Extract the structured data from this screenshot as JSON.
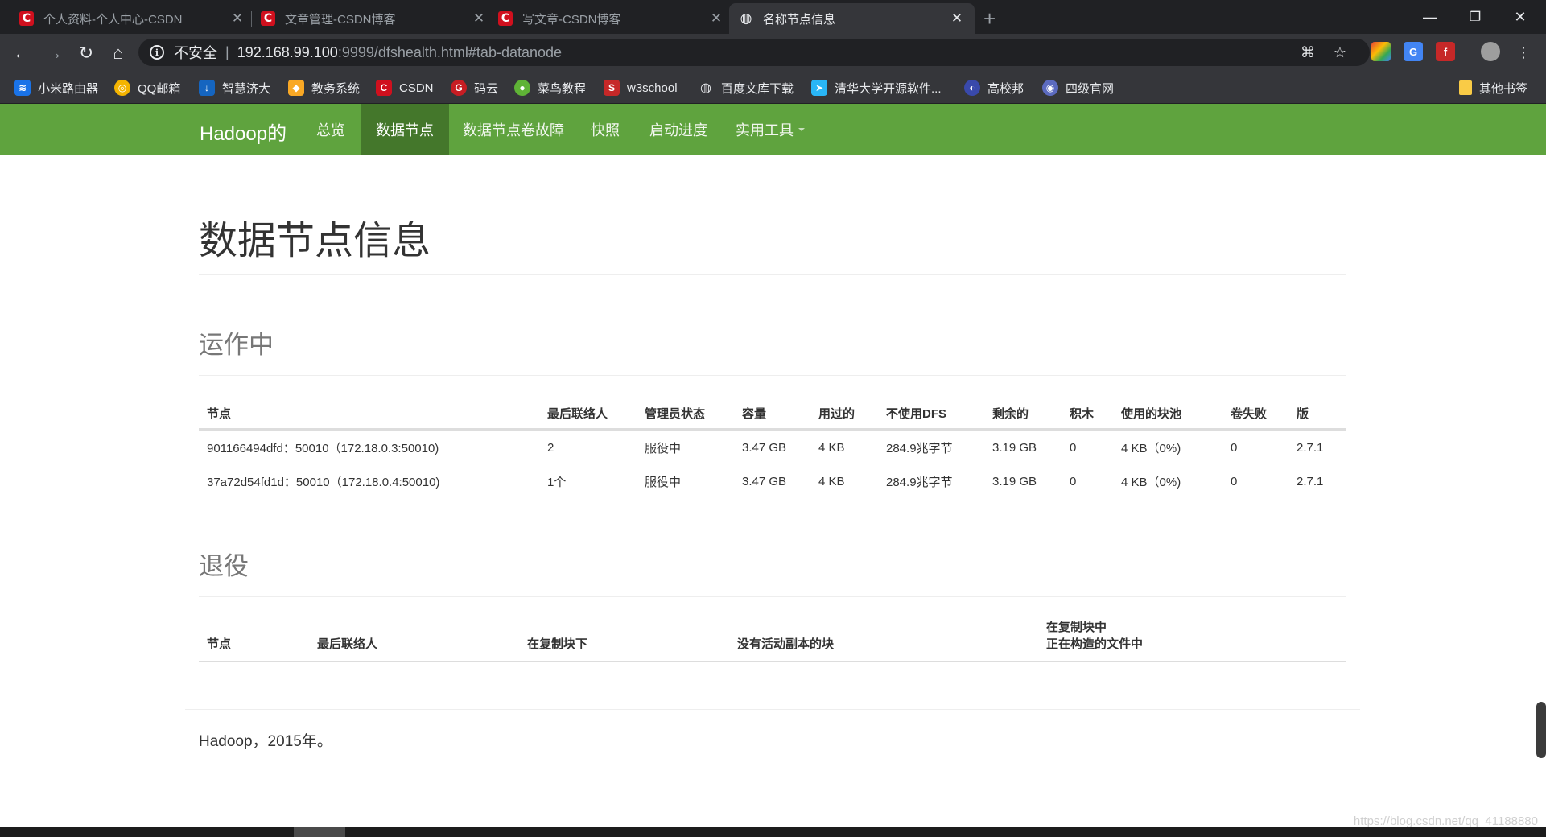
{
  "browser": {
    "tabs": [
      {
        "title": "个人资料-个人中心-CSDN",
        "icon": "csdn-icon",
        "active": false
      },
      {
        "title": "文章管理-CSDN博客",
        "icon": "csdn-icon",
        "active": false
      },
      {
        "title": "写文章-CSDN博客",
        "icon": "csdn-icon",
        "active": false
      },
      {
        "title": "名称节点信息",
        "icon": "globe-icon",
        "active": true
      }
    ],
    "address": {
      "insecure_label": "不安全",
      "host": "192.168.99.100",
      "path": ":9999/dfshealth.html#tab-datanode"
    },
    "bookmarks": [
      {
        "label": "小米路由器",
        "icon": "wifi-icon",
        "color": "#1a73e8"
      },
      {
        "label": "QQ邮箱",
        "icon": "qq-mail-icon",
        "color": "#f4b400"
      },
      {
        "label": "智慧济大",
        "icon": "download-icon",
        "color": "#1565c0"
      },
      {
        "label": "教务系统",
        "icon": "layers-icon",
        "color": "#f9a825"
      },
      {
        "label": "CSDN",
        "icon": "csdn-icon",
        "color": "#d0101e"
      },
      {
        "label": "码云",
        "icon": "gitee-icon",
        "color": "#c71d23"
      },
      {
        "label": "菜鸟教程",
        "icon": "runoob-icon",
        "color": "#5fb336"
      },
      {
        "label": "w3school",
        "icon": "w3school-icon",
        "color": "#c62828"
      },
      {
        "label": "百度文库下载",
        "icon": "globe-icon",
        "color": "#e8eaed"
      },
      {
        "label": "清华大学开源软件...",
        "icon": "tuna-icon",
        "color": "#29b6f6"
      },
      {
        "label": "高校邦",
        "icon": "gaoxiaobang-icon",
        "color": "#3949ab"
      },
      {
        "label": "四级官网",
        "icon": "cet-icon",
        "color": "#5c6bc0"
      },
      {
        "label": "其他书签",
        "icon": "folder-icon",
        "color": "#f9cb46"
      }
    ]
  },
  "navbar": {
    "brand": "Hadoop的",
    "items": [
      {
        "label": "总览",
        "active": false
      },
      {
        "label": "数据节点",
        "active": true
      },
      {
        "label": "数据节点卷故障",
        "active": false
      },
      {
        "label": "快照",
        "active": false
      },
      {
        "label": "启动进度",
        "active": false
      },
      {
        "label": "实用工具",
        "active": false,
        "dropdown": true
      }
    ]
  },
  "page": {
    "title": "数据节点信息",
    "in_operation": {
      "heading": "运作中",
      "columns": [
        "节点",
        "最后联络人",
        "管理员状态",
        "容量",
        "用过的",
        "不使用DFS",
        "剩余的",
        "积木",
        "使用的块池",
        "卷失败",
        "版"
      ],
      "rows": [
        [
          "901166494dfd：50010（172.18.0.3:50010)",
          "2",
          "服役中",
          "3.47 GB",
          "4 KB",
          "284.9兆字节",
          "3.19 GB",
          "0",
          "4 KB（0%)",
          "0",
          "2.7.1"
        ],
        [
          "37a72d54fd1d：50010（172.18.0.4:50010)",
          "1个",
          "服役中",
          "3.47 GB",
          "4 KB",
          "284.9兆字节",
          "3.19 GB",
          "0",
          "4 KB（0%)",
          "0",
          "2.7.1"
        ]
      ]
    },
    "decommissioning": {
      "heading": "退役",
      "columns": [
        "节点",
        "最后联络人",
        "在复制块下",
        "没有活动副本的块",
        "在复制块中"
      ],
      "last_column_line2": "正在构造的文件中"
    },
    "footer": "Hadoop，2015年。"
  },
  "watermark": "https://blog.csdn.net/qq_41188880"
}
